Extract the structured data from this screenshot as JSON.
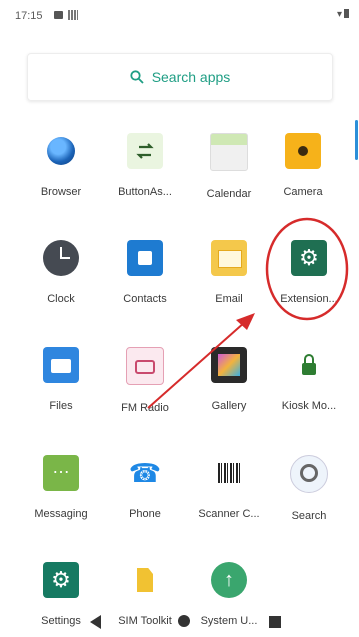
{
  "status_bar": {
    "time": "17:15"
  },
  "search": {
    "label": "Search apps"
  },
  "apps": [
    "Browser",
    "ButtonAs...",
    "Calendar",
    "Camera",
    "Clock",
    "Contacts",
    "Email",
    "Extension...",
    "Files",
    "FM Radio",
    "Gallery",
    "Kiosk Mo...",
    "Messaging",
    "Phone",
    "Scanner C...",
    "Search",
    "Settings",
    "SIM Toolkit",
    "System U..."
  ],
  "annotation": {
    "color": "#d62b2b",
    "target": "Extension..."
  }
}
